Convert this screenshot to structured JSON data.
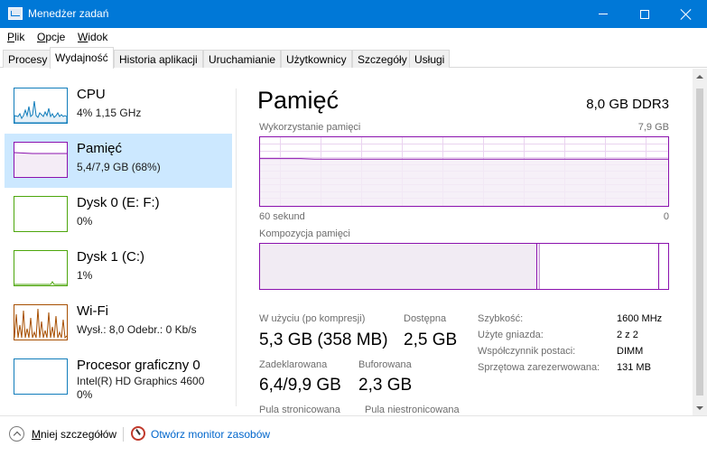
{
  "window": {
    "title": "Menedżer zadań"
  },
  "menu": [
    "Plik",
    "Opcje",
    "Widok"
  ],
  "tabs": [
    {
      "label": "Procesy",
      "active": false
    },
    {
      "label": "Wydajność",
      "active": true
    },
    {
      "label": "Historia aplikacji",
      "active": false
    },
    {
      "label": "Uruchamianie",
      "active": false
    },
    {
      "label": "Użytkownicy",
      "active": false
    },
    {
      "label": "Szczegóły",
      "active": false
    },
    {
      "label": "Usługi",
      "active": false
    }
  ],
  "sidebar": {
    "items": [
      {
        "title": "CPU",
        "subtitle": "4%  1,15 GHz",
        "subtitle2": "",
        "color": "#117dbb",
        "selected": false
      },
      {
        "title": "Pamięć",
        "subtitle": "5,4/7,9 GB (68%)",
        "subtitle2": "",
        "color": "#8b12ae",
        "selected": true
      },
      {
        "title": "Dysk 0 (E: F:)",
        "subtitle": "0%",
        "subtitle2": "",
        "color": "#4da60c",
        "selected": false
      },
      {
        "title": "Dysk 1 (C:)",
        "subtitle": "1%",
        "subtitle2": "",
        "color": "#4da60c",
        "selected": false
      },
      {
        "title": "Wi-Fi",
        "subtitle": "Wysł.: 8,0  Odebr.: 0 Kb/s",
        "subtitle2": "",
        "color": "#a74f01",
        "selected": false
      },
      {
        "title": "Procesor graficzny 0",
        "subtitle": "Intel(R) HD Graphics 4600",
        "subtitle2": "0%",
        "color": "#117dbb",
        "selected": false
      }
    ]
  },
  "memory": {
    "title": "Pamięć",
    "spec": "8,0 GB DDR3",
    "usage_label": "Wykorzystanie pamięci",
    "usage_max": "7,9 GB",
    "time_left": "60 sekund",
    "time_right": "0",
    "composition_label": "Kompozycja pamięci",
    "in_use_label": "W użyciu (po kompresji)",
    "in_use_value": "5,3 GB (358 MB)",
    "available_label": "Dostępna",
    "available_value": "2,5 GB",
    "committed_label": "Zadeklarowana",
    "committed_value": "6,4/9,9 GB",
    "cached_label": "Buforowana",
    "cached_value": "2,3 GB",
    "paged_label": "Pula stronicowana",
    "nonpaged_label": "Pula niestronicowana",
    "details": [
      {
        "label": "Szybkość:",
        "value": "1600 MHz"
      },
      {
        "label": "Użyte gniazda:",
        "value": "2 z 2"
      },
      {
        "label": "Współczynnik postaci:",
        "value": "DIMM"
      },
      {
        "label": "Sprzętowa zarezerwowana:",
        "value": "131 MB"
      }
    ],
    "usage_history_percent": [
      69,
      69,
      69,
      69,
      68,
      68,
      68,
      68,
      68,
      68,
      68,
      68,
      68,
      68,
      68,
      68,
      68,
      68,
      68,
      68,
      68,
      68,
      68,
      68,
      68,
      68,
      68,
      68,
      68,
      68,
      68
    ]
  },
  "footer": {
    "fewer_details": "Mniej szczegółów",
    "open_monitor": "Otwórz monitor zasobów"
  }
}
